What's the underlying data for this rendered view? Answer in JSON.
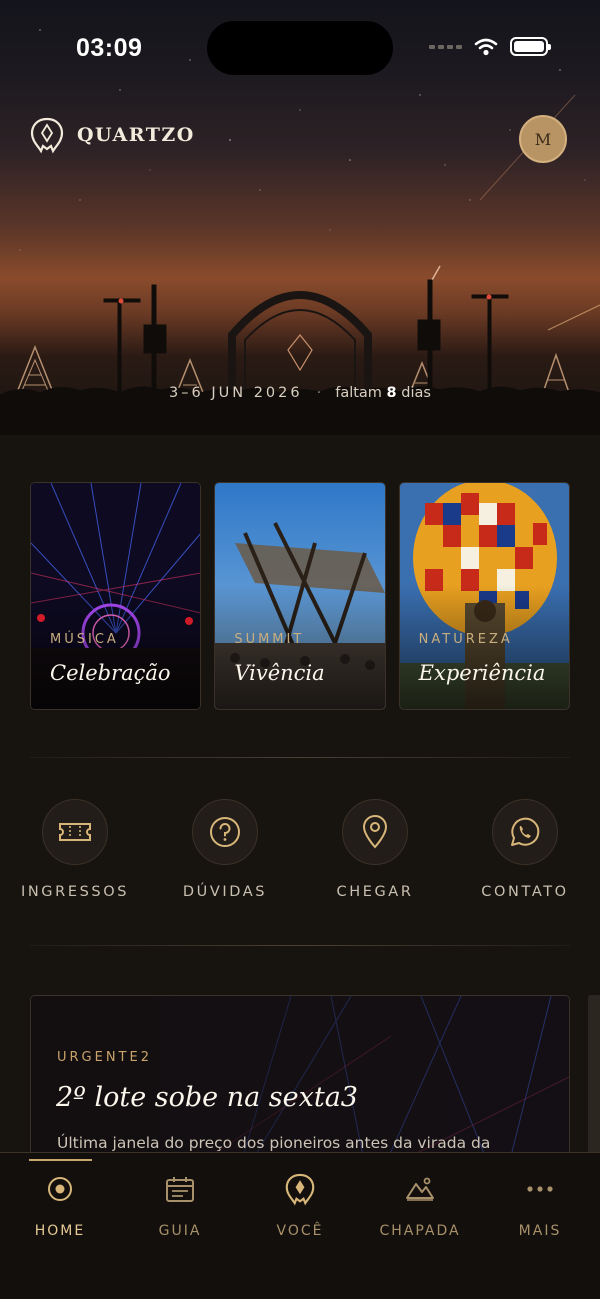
{
  "status_bar": {
    "time": "03:09"
  },
  "header": {
    "brand": "QUARTZO",
    "avatar_initial": "M"
  },
  "hero": {
    "date_range": "3–6 JUN 2026",
    "separator": "·",
    "countdown_prefix": "faltam",
    "countdown_days": "8",
    "countdown_suffix": "dias"
  },
  "categories": [
    {
      "kicker": "MÚSICA",
      "title": "Celebração"
    },
    {
      "kicker": "SUMMIT",
      "title": "Vivência"
    },
    {
      "kicker": "NATUREZA",
      "title": "Experiência"
    }
  ],
  "actions": [
    {
      "label": "INGRESSOS",
      "icon": "ticket-icon"
    },
    {
      "label": "DÚVIDAS",
      "icon": "question-icon"
    },
    {
      "label": "CHEGAR",
      "icon": "location-pin-icon"
    },
    {
      "label": "CONTATO",
      "icon": "whatsapp-icon"
    }
  ],
  "news": {
    "kicker": "URGENTE2",
    "headline": "2º lote sobe na sexta3",
    "body": "Última janela do preço dos pioneiros antes da virada da"
  },
  "tabbar": {
    "active": "HOME",
    "items": [
      {
        "label": "HOME",
        "icon": "home-dot-icon"
      },
      {
        "label": "GUIA",
        "icon": "calendar-icon"
      },
      {
        "label": "VOCÊ",
        "icon": "quartzo-logo-icon"
      },
      {
        "label": "CHAPADA",
        "icon": "mountain-icon"
      },
      {
        "label": "MAIS",
        "icon": "more-icon"
      }
    ]
  },
  "colors": {
    "accent": "#c8a86f",
    "background": "#171410",
    "avatar": "#b89465"
  }
}
